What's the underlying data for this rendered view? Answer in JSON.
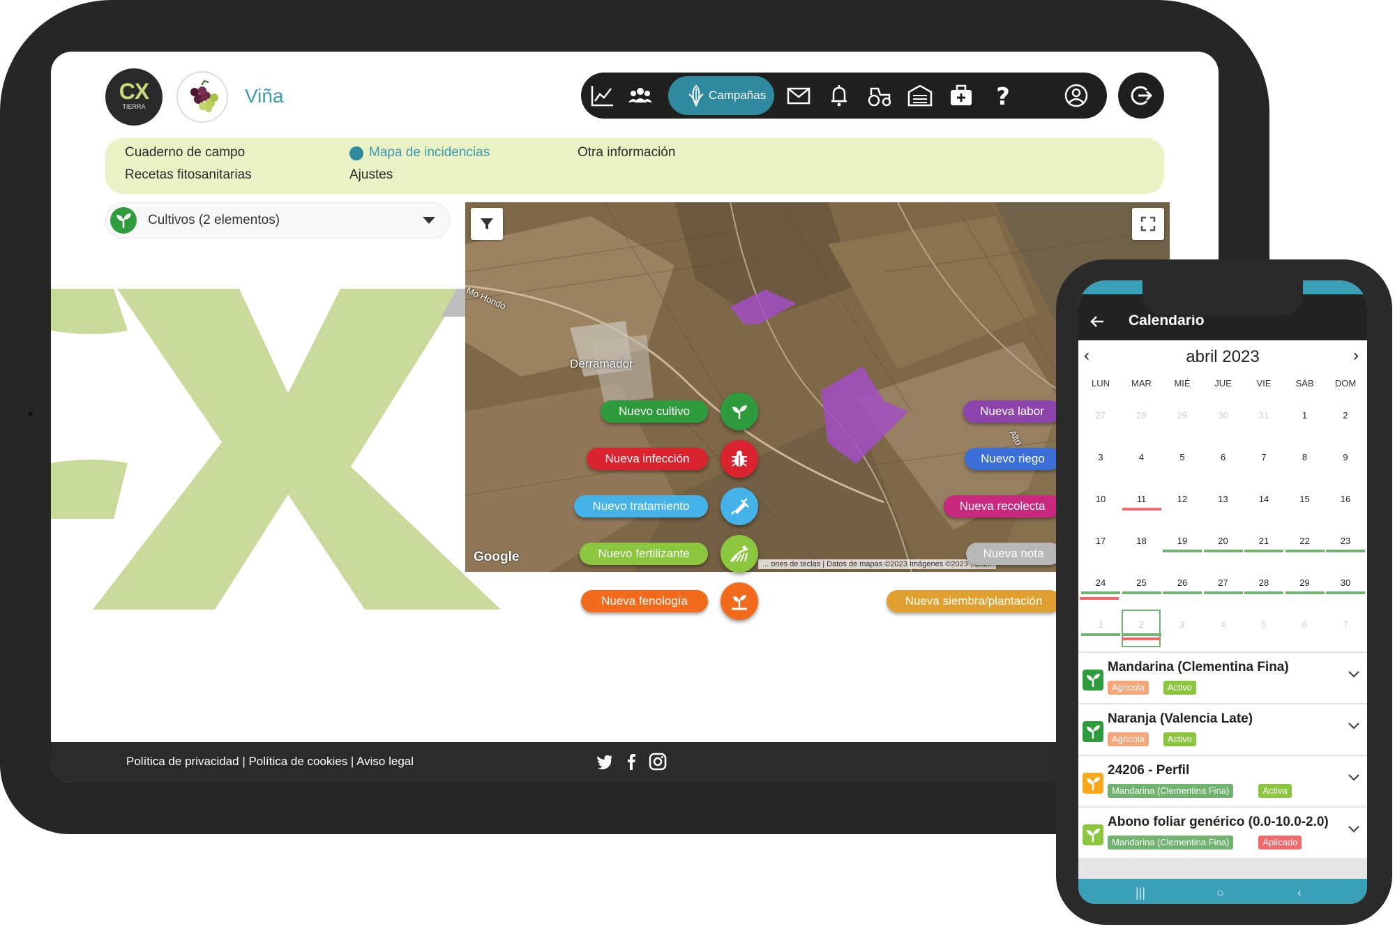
{
  "app": {
    "title": "Viña",
    "logo_text": "CX",
    "logo_sub": "TIERRA",
    "nav_active_label": "Campañas",
    "nav_icons": [
      "chart-icon",
      "users-icon",
      "campaigns-icon",
      "mail-icon",
      "bell-icon",
      "tractor-icon",
      "warehouse-icon",
      "medkit-icon",
      "help-icon",
      "account-icon",
      "logout-icon"
    ]
  },
  "subnav": {
    "items": [
      "Cuaderno de campo",
      "Recetas fitosanitarias",
      "Mapa de incidencias",
      "Ajustes",
      "Otra información"
    ],
    "active": "Mapa de incidencias"
  },
  "crop_select": {
    "label": "Cultivos (2 elementos)"
  },
  "map": {
    "place_label": "Derramador",
    "road_label_1": "Mo Hondo",
    "road_label_2": "Alto",
    "google": "Google",
    "attribution": "... ones de teclas | Datos de mapas ©2023 Imágenes ©2023 , CN..."
  },
  "actions": {
    "left": [
      {
        "label": "Nuevo cultivo",
        "color": "#2e9b3d"
      },
      {
        "label": "Nueva infección",
        "color": "#d9232e"
      },
      {
        "label": "Nuevo tratamiento",
        "color": "#45b3e8"
      },
      {
        "label": "Nuevo fertilizante",
        "color": "#8cc63f"
      },
      {
        "label": "Nueva fenología",
        "color": "#f26b1d"
      }
    ],
    "right": [
      {
        "label": "Nueva labor",
        "color": "#8e44ad"
      },
      {
        "label": "Nuevo riego",
        "color": "#3b6fd8"
      },
      {
        "label": "Nueva recolecta",
        "color": "#c8287e"
      },
      {
        "label": "Nueva nota",
        "color": "#b8b8b8"
      },
      {
        "label": "Nueva siembra/plantación",
        "color": "#e0a030"
      }
    ]
  },
  "footer": {
    "links": "Política de privacidad | Política de cookies | Aviso legal",
    "social": [
      "twitter-icon",
      "facebook-icon",
      "instagram-icon"
    ]
  },
  "phone": {
    "title": "Calendario",
    "month": "abril 2023",
    "weekdays": [
      "LUN",
      "MAR",
      "MIÉ",
      "JUE",
      "VIE",
      "SÁB",
      "DOM"
    ],
    "weeks": [
      [
        "27",
        "28",
        "29",
        "30",
        "31",
        "1",
        "2"
      ],
      [
        "3",
        "4",
        "5",
        "6",
        "7",
        "8",
        "9"
      ],
      [
        "10",
        "11",
        "12",
        "13",
        "14",
        "15",
        "16"
      ],
      [
        "17",
        "18",
        "19",
        "20",
        "21",
        "22",
        "23"
      ],
      [
        "24",
        "25",
        "26",
        "27",
        "28",
        "29",
        "30"
      ],
      [
        "1",
        "2",
        "3",
        "4",
        "5",
        "6",
        "7"
      ]
    ],
    "events": [
      {
        "title": "Mandarina (Clementina Fina)",
        "icon_color": "#2e9b3d",
        "tags": [
          {
            "label": "Agricola",
            "color": "#f5a67a"
          },
          {
            "label": "Activo",
            "color": "#8cc63f"
          }
        ]
      },
      {
        "title": "Naranja (Valencia Late)",
        "icon_color": "#2e9b3d",
        "tags": [
          {
            "label": "Agricola",
            "color": "#f5a67a"
          },
          {
            "label": "Activo",
            "color": "#8cc63f"
          }
        ]
      },
      {
        "title": "24206 - Perfil",
        "icon_color": "#f7a81b",
        "tags": [
          {
            "label": "Mandarina (Clementina Fina)",
            "color": "#6fb36f"
          },
          {
            "label": "Activa",
            "color": "#8cc63f"
          }
        ]
      },
      {
        "title": "Abono foliar genérico (0.0-10.0-2.0)",
        "icon_color": "#8cc63f",
        "tags": [
          {
            "label": "Mandarina (Clementina Fina)",
            "color": "#6fb36f"
          },
          {
            "label": "Aplicado",
            "color": "#ef6b6b"
          }
        ]
      }
    ]
  }
}
